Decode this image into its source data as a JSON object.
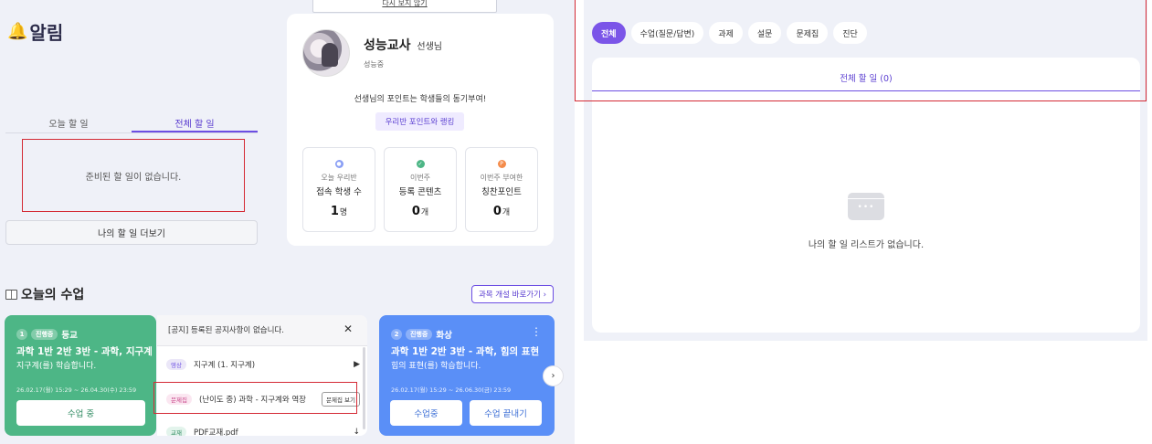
{
  "tooltip": {
    "text": "다시 보지 않기"
  },
  "alerts": {
    "title": "알림",
    "tabs": [
      "오늘 할 일",
      "전체 할 일"
    ],
    "active_tab": 1,
    "empty_text": "준비된 할 일이 없습니다.",
    "more_button": "나의 할 일 더보기"
  },
  "profile": {
    "name": "성능교사",
    "title": "선생님",
    "school": "성능중",
    "points_message": "선생님의 포인트는 학생들의 동기부여!",
    "ranking_button": "우리반 포인트와 랭킹",
    "stats": [
      {
        "sub": "오늘 우리반",
        "main": "접속 학생 수",
        "value": "1",
        "unit": "명",
        "icon_color": "#8a9ff5"
      },
      {
        "sub": "이번주",
        "main": "등록 콘텐츠",
        "value": "0",
        "unit": "개",
        "icon_color": "#4db686"
      },
      {
        "sub": "이번주 부여한",
        "main": "칭찬포인트",
        "value": "0",
        "unit": "개",
        "icon_color": "#f48b4a"
      }
    ]
  },
  "today_class": {
    "title": "오늘의 수업",
    "course_link": "과목 개설 바로가기 ›",
    "cards": [
      {
        "num": "1",
        "state": "진행중",
        "day": "등교",
        "course": "과학 1반 2반 3반 - 과학, 지구계",
        "desc": "지구계(를) 학습합니다.",
        "date": "26.02.17(월) 15:29 ~ 26.04.30(수) 23:59",
        "button": "수업 중",
        "color": "#4db686"
      },
      {
        "num": "2",
        "state": "진행중",
        "day": "화상",
        "course": "과학 1반 2반 3반 - 과학, 힘의 표현",
        "desc": "힘의 표현(를) 학습합니다.",
        "date": "26.02.17(월) 15:29 ~ 26.06.30(금) 23:59",
        "buttons": [
          "수업중",
          "수업 끝내기"
        ],
        "color": "#5a8ff7"
      }
    ],
    "notice": {
      "text": "[공지] 등록된 공지사항이 없습니다.",
      "items": [
        {
          "tag": "영상",
          "text": "지구계 (1. 지구계)",
          "action_icon": "play-icon"
        },
        {
          "tag": "문제집",
          "text": "(난이도 중) 과학 - 지구계와 역장",
          "action": "문제집 보기"
        },
        {
          "tag": "교재",
          "text": "PDF교재.pdf",
          "action_icon": "download-icon"
        }
      ]
    }
  },
  "right": {
    "filters": [
      "전체",
      "수업(질문/답변)",
      "과제",
      "설문",
      "문제집",
      "진단"
    ],
    "active_filter": 0,
    "list_tab": "전체 할 일 (0)",
    "empty_text": "나의 할 일 리스트가 없습니다."
  }
}
